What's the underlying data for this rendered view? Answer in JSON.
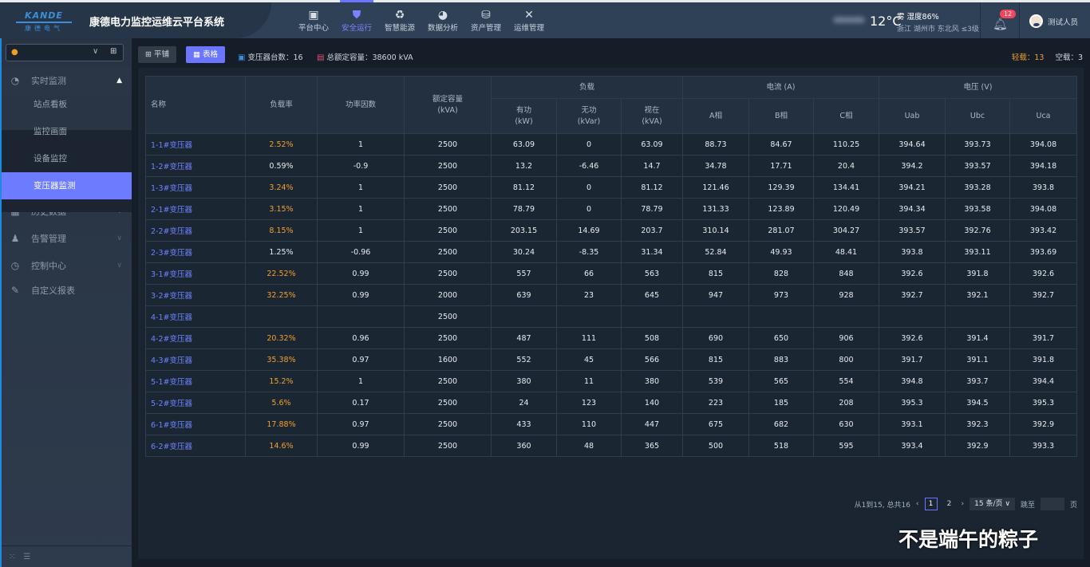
{
  "header": {
    "logo_text": "KANDE",
    "logo_cn": "康德电气",
    "title": "康德电力监控运维云平台系统",
    "nav": [
      {
        "label": "平台中心",
        "icon": "monitor-icon"
      },
      {
        "label": "安全运行",
        "icon": "shield-icon"
      },
      {
        "label": "智慧能源",
        "icon": "recycle-icon"
      },
      {
        "label": "数据分析",
        "icon": "pie-chart-icon"
      },
      {
        "label": "资产管理",
        "icon": "database-icon"
      },
      {
        "label": "运维管理",
        "icon": "tools-icon"
      }
    ],
    "active_nav": "安全运行",
    "weather": {
      "temp": "12°C",
      "condition": "雾 湿度86%",
      "location": "浙江 湖州市 东北风 ≤3级"
    },
    "notifications": "12",
    "user": "测试人员"
  },
  "sidebar": {
    "groups": [
      {
        "label": "实时监测",
        "icon": "gauge-icon"
      },
      {
        "label": "历史数据",
        "icon": "calendar-icon"
      },
      {
        "label": "告警管理",
        "icon": "alarm-bell-icon"
      },
      {
        "label": "控制中心",
        "icon": "clock-icon"
      },
      {
        "label": "自定义报表",
        "icon": "report-icon"
      }
    ],
    "sub_items": [
      "站点看板",
      "监控画面",
      "设备监控",
      "变压器监测"
    ],
    "active_sub": "变压器监测"
  },
  "toolbar": {
    "flat_label": "平铺",
    "table_label": "表格",
    "count_label": "变压器台数：16",
    "capacity_label": "总额定容量：38600 kVA",
    "light_label": "轻载：",
    "light_value": "13",
    "idle_label": "空载：",
    "idle_value": "3"
  },
  "table": {
    "h": {
      "name": "名称",
      "rate": "负载率",
      "pf": "功率因数",
      "cap": "额定容量",
      "cap_unit": "(kVA)",
      "load": "负载",
      "p": "有功",
      "p_unit": "(kW)",
      "q": "无功",
      "q_unit": "(kVar)",
      "s": "视在",
      "s_unit": "(kVA)",
      "current": "电流 (A)",
      "ia": "A相",
      "ib": "B相",
      "ic": "C相",
      "voltage": "电压 (V)",
      "uab": "Uab",
      "ubc": "Ubc",
      "uca": "Uca"
    },
    "rows": [
      [
        "1-1#变压器",
        "2.52%",
        "1",
        "2500",
        "63.09",
        "0",
        "63.09",
        "88.73",
        "84.67",
        "110.25",
        "394.64",
        "393.73",
        "394.08"
      ],
      [
        "1-2#变压器",
        "0.59%",
        "-0.9",
        "2500",
        "13.2",
        "-6.46",
        "14.7",
        "34.78",
        "17.71",
        "20.4",
        "394.2",
        "393.57",
        "394.18"
      ],
      [
        "1-3#变压器",
        "3.24%",
        "1",
        "2500",
        "81.12",
        "0",
        "81.12",
        "121.46",
        "129.39",
        "134.41",
        "394.21",
        "393.28",
        "393.8"
      ],
      [
        "2-1#变压器",
        "3.15%",
        "1",
        "2500",
        "78.79",
        "0",
        "78.79",
        "131.33",
        "123.89",
        "120.49",
        "394.34",
        "393.58",
        "394.08"
      ],
      [
        "2-2#变压器",
        "8.15%",
        "1",
        "2500",
        "203.15",
        "14.69",
        "203.7",
        "310.14",
        "281.07",
        "304.27",
        "393.57",
        "392.76",
        "393.42"
      ],
      [
        "2-3#变压器",
        "1.25%",
        "-0.96",
        "2500",
        "30.24",
        "-8.35",
        "31.34",
        "52.84",
        "49.93",
        "48.41",
        "393.8",
        "393.11",
        "393.69"
      ],
      [
        "3-1#变压器",
        "22.52%",
        "0.99",
        "2500",
        "557",
        "66",
        "563",
        "815",
        "828",
        "848",
        "392.6",
        "391.8",
        "392.6"
      ],
      [
        "3-2#变压器",
        "32.25%",
        "0.99",
        "2000",
        "639",
        "23",
        "645",
        "947",
        "973",
        "928",
        "392.7",
        "392.1",
        "392.7"
      ],
      [
        "4-1#变压器",
        "",
        "",
        "2500",
        "",
        "",
        "",
        "",
        "",
        "",
        "",
        "",
        ""
      ],
      [
        "4-2#变压器",
        "20.32%",
        "0.96",
        "2500",
        "487",
        "111",
        "508",
        "690",
        "650",
        "906",
        "392.6",
        "391.4",
        "391.7"
      ],
      [
        "4-3#变压器",
        "35.38%",
        "0.97",
        "1600",
        "552",
        "45",
        "566",
        "815",
        "883",
        "800",
        "391.7",
        "391.1",
        "391.8"
      ],
      [
        "5-1#变压器",
        "15.2%",
        "1",
        "2500",
        "380",
        "11",
        "380",
        "539",
        "565",
        "554",
        "394.8",
        "393.7",
        "394.4"
      ],
      [
        "5-2#变压器",
        "5.6%",
        "0.17",
        "2500",
        "24",
        "123",
        "140",
        "223",
        "185",
        "208",
        "395.3",
        "394.5",
        "395.3"
      ],
      [
        "6-1#变压器",
        "17.88%",
        "0.97",
        "2500",
        "433",
        "110",
        "447",
        "675",
        "682",
        "630",
        "393.1",
        "392.3",
        "392.9"
      ],
      [
        "6-2#变压器",
        "14.6%",
        "0.99",
        "2500",
        "360",
        "48",
        "365",
        "500",
        "518",
        "595",
        "393.4",
        "392.9",
        "393.3"
      ]
    ],
    "warn_rows": [
      0,
      2,
      3,
      4,
      6,
      7,
      9,
      10,
      11,
      12,
      13,
      14
    ]
  },
  "pager": {
    "summary": "从1到15, 总共16",
    "pages": [
      "1",
      "2"
    ],
    "current": "1",
    "page_size": "15 条/页",
    "jump_label": "跳至",
    "page_suffix": "页"
  },
  "watermark": "不是端午的粽子",
  "colors": {
    "accent": "#6c75ff",
    "warn": "#f0a030",
    "link": "#6f82ff"
  }
}
